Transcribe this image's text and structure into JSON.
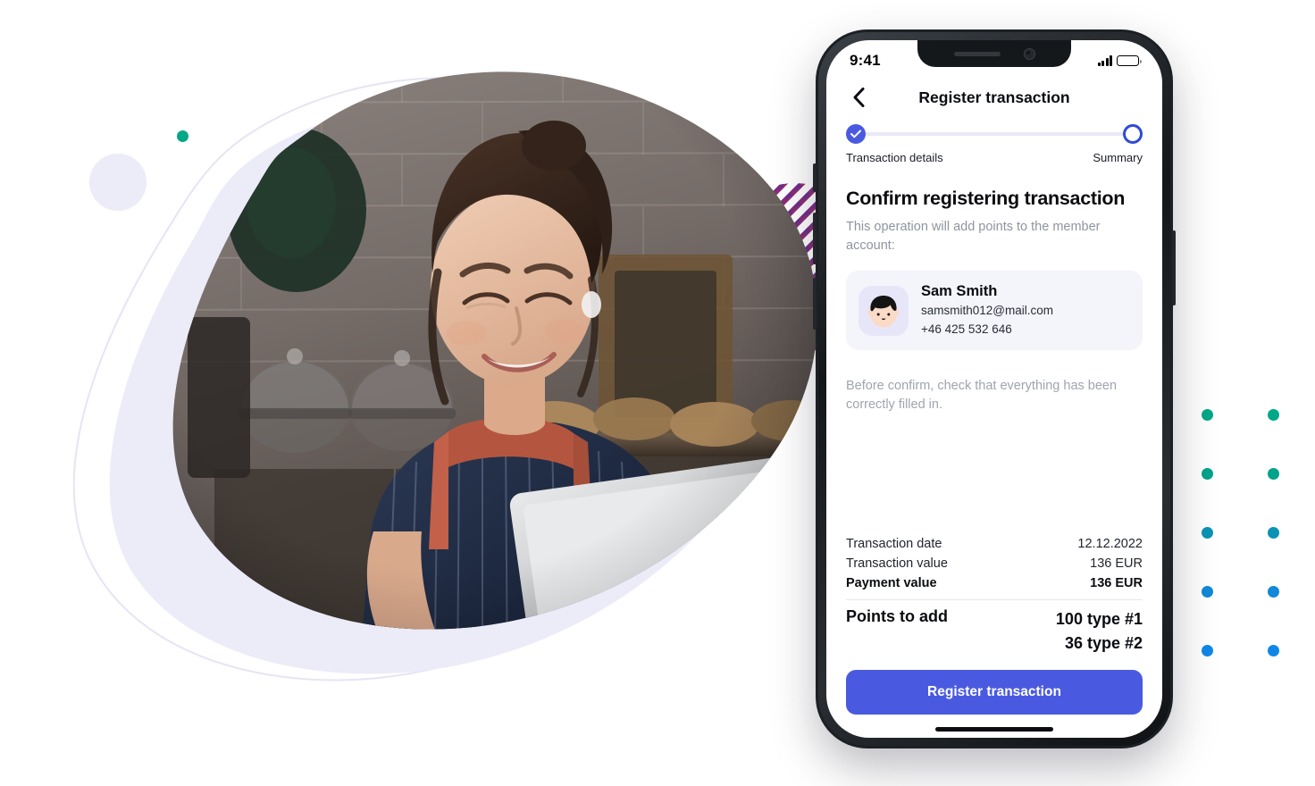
{
  "phone": {
    "status_bar": {
      "time": "9:41",
      "signal_icon": "cellular-signal-icon",
      "battery_icon": "battery-full-icon"
    },
    "nav": {
      "back_icon": "chevron-left-icon",
      "title": "Register transaction"
    },
    "stepper": {
      "steps": [
        {
          "label": "Transaction details",
          "state": "completed",
          "icon": "check-icon"
        },
        {
          "label": "Summary",
          "state": "current",
          "icon": "circle-outline-icon"
        }
      ]
    },
    "content": {
      "heading": "Confirm registering transaction",
      "subheading": "This operation will add points to the member account:",
      "hint": "Before confirm, check that everything has been correctly filled in."
    },
    "member": {
      "avatar_icon": "user-avatar-icon",
      "name": "Sam Smith",
      "email": "samsmith012@mail.com",
      "phone": "+46 425 532 646"
    },
    "summary": {
      "rows": [
        {
          "label": "Transaction date",
          "value": "12.12.2022",
          "strong": false
        },
        {
          "label": "Transaction value",
          "value": "136 EUR",
          "strong": false
        },
        {
          "label": "Payment value",
          "value": "136 EUR",
          "strong": true
        }
      ],
      "points": {
        "label": "Points to add",
        "values": [
          "100 type #1",
          "36 type #2"
        ]
      }
    },
    "cta": {
      "label": "Register transaction"
    }
  },
  "decor": {
    "photo_alt": "woman-with-tablet-photo",
    "blob_color": "#ECEBF8",
    "accent_blue": "#4A5AE0",
    "teal_dot": "#00A887",
    "blue_dot": "#1087E8",
    "stripe_start": "#5B2D9B",
    "stripe_end": "#A32E63",
    "dot_grid": {
      "columns": 2,
      "rows": 5,
      "colors": [
        "#00A887",
        "#00A28C",
        "#0C93B4",
        "#1188D8",
        "#1087E8"
      ]
    }
  }
}
